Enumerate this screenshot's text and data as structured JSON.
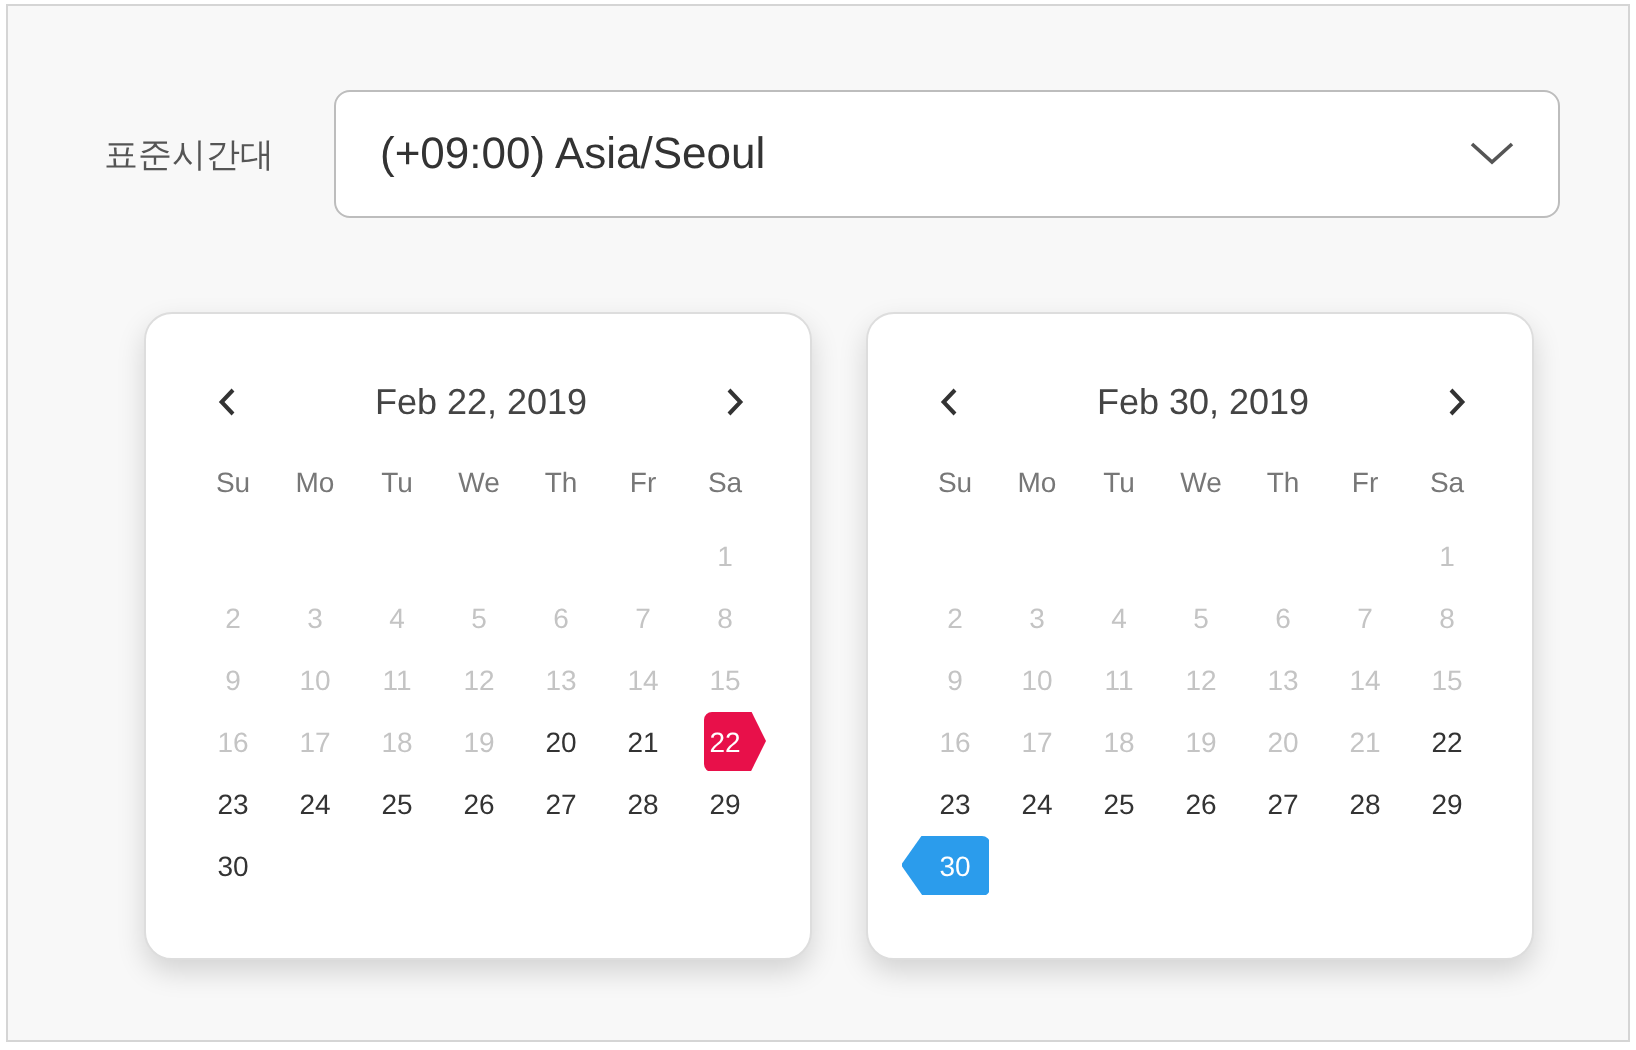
{
  "timezone": {
    "label": "표준시간대",
    "value": "(+09:00) Asia/Seoul"
  },
  "calendars": [
    {
      "title": "Feb 22, 2019",
      "kind": "start",
      "color": "#e8104a",
      "weekdays": [
        "Su",
        "Mo",
        "Tu",
        "We",
        "Th",
        "Fr",
        "Sa"
      ],
      "weeks": [
        [
          {
            "label": "1",
            "disabled": true,
            "selected": false
          }
        ],
        [
          {
            "label": "2",
            "disabled": true,
            "selected": false
          },
          {
            "label": "3",
            "disabled": true,
            "selected": false
          },
          {
            "label": "4",
            "disabled": true,
            "selected": false
          },
          {
            "label": "5",
            "disabled": true,
            "selected": false
          },
          {
            "label": "6",
            "disabled": true,
            "selected": false
          },
          {
            "label": "7",
            "disabled": true,
            "selected": false
          },
          {
            "label": "8",
            "disabled": true,
            "selected": false
          }
        ],
        [
          {
            "label": "9",
            "disabled": true,
            "selected": false
          },
          {
            "label": "10",
            "disabled": true,
            "selected": false
          },
          {
            "label": "11",
            "disabled": true,
            "selected": false
          },
          {
            "label": "12",
            "disabled": true,
            "selected": false
          },
          {
            "label": "13",
            "disabled": true,
            "selected": false
          },
          {
            "label": "14",
            "disabled": true,
            "selected": false
          },
          {
            "label": "15",
            "disabled": true,
            "selected": false
          }
        ],
        [
          {
            "label": "16",
            "disabled": true,
            "selected": false
          },
          {
            "label": "17",
            "disabled": true,
            "selected": false
          },
          {
            "label": "18",
            "disabled": true,
            "selected": false
          },
          {
            "label": "19",
            "disabled": true,
            "selected": false
          },
          {
            "label": "20",
            "disabled": false,
            "selected": false
          },
          {
            "label": "21",
            "disabled": false,
            "selected": false
          },
          {
            "label": "22",
            "disabled": false,
            "selected": true
          }
        ],
        [
          {
            "label": "23",
            "disabled": false,
            "selected": false
          },
          {
            "label": "24",
            "disabled": false,
            "selected": false
          },
          {
            "label": "25",
            "disabled": false,
            "selected": false
          },
          {
            "label": "26",
            "disabled": false,
            "selected": false
          },
          {
            "label": "27",
            "disabled": false,
            "selected": false
          },
          {
            "label": "28",
            "disabled": false,
            "selected": false
          },
          {
            "label": "29",
            "disabled": false,
            "selected": false
          }
        ],
        [
          {
            "label": "30",
            "disabled": false,
            "selected": false
          }
        ]
      ]
    },
    {
      "title": "Feb 30, 2019",
      "kind": "end",
      "color": "#2b9cec",
      "weekdays": [
        "Su",
        "Mo",
        "Tu",
        "We",
        "Th",
        "Fr",
        "Sa"
      ],
      "weeks": [
        [
          {
            "label": "1",
            "disabled": true,
            "selected": false
          }
        ],
        [
          {
            "label": "2",
            "disabled": true,
            "selected": false
          },
          {
            "label": "3",
            "disabled": true,
            "selected": false
          },
          {
            "label": "4",
            "disabled": true,
            "selected": false
          },
          {
            "label": "5",
            "disabled": true,
            "selected": false
          },
          {
            "label": "6",
            "disabled": true,
            "selected": false
          },
          {
            "label": "7",
            "disabled": true,
            "selected": false
          },
          {
            "label": "8",
            "disabled": true,
            "selected": false
          }
        ],
        [
          {
            "label": "9",
            "disabled": true,
            "selected": false
          },
          {
            "label": "10",
            "disabled": true,
            "selected": false
          },
          {
            "label": "11",
            "disabled": true,
            "selected": false
          },
          {
            "label": "12",
            "disabled": true,
            "selected": false
          },
          {
            "label": "13",
            "disabled": true,
            "selected": false
          },
          {
            "label": "14",
            "disabled": true,
            "selected": false
          },
          {
            "label": "15",
            "disabled": true,
            "selected": false
          }
        ],
        [
          {
            "label": "16",
            "disabled": true,
            "selected": false
          },
          {
            "label": "17",
            "disabled": true,
            "selected": false
          },
          {
            "label": "18",
            "disabled": true,
            "selected": false
          },
          {
            "label": "19",
            "disabled": true,
            "selected": false
          },
          {
            "label": "20",
            "disabled": true,
            "selected": false
          },
          {
            "label": "21",
            "disabled": true,
            "selected": false
          },
          {
            "label": "22",
            "disabled": false,
            "selected": false
          }
        ],
        [
          {
            "label": "23",
            "disabled": false,
            "selected": false
          },
          {
            "label": "24",
            "disabled": false,
            "selected": false
          },
          {
            "label": "25",
            "disabled": false,
            "selected": false
          },
          {
            "label": "26",
            "disabled": false,
            "selected": false
          },
          {
            "label": "27",
            "disabled": false,
            "selected": false
          },
          {
            "label": "28",
            "disabled": false,
            "selected": false
          },
          {
            "label": "29",
            "disabled": false,
            "selected": false
          }
        ],
        [
          {
            "label": "30",
            "disabled": false,
            "selected": true
          }
        ]
      ]
    }
  ]
}
